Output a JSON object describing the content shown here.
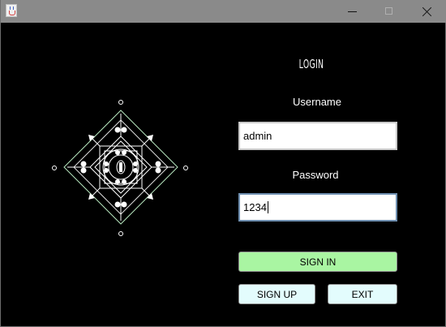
{
  "window": {
    "app_icon": "java-cup-icon",
    "controls": [
      "minimize-icon",
      "maximize-icon",
      "close-icon"
    ]
  },
  "logo": {
    "icon": "ornamental-diamond-emblem-icon"
  },
  "login": {
    "title": "LOGIN",
    "username_label": "Username",
    "username_value": "admin",
    "password_label": "Password",
    "password_value": "1234",
    "signin_label": "SIGN IN",
    "signup_label": "SIGN UP",
    "exit_label": "EXIT"
  },
  "colors": {
    "background": "#000000",
    "titlebar": "#8a8a8a",
    "signin_button": "#a9f5a2",
    "secondary_buttons": "#e3fcfd",
    "emblem_outer": "#b8e8c0"
  }
}
